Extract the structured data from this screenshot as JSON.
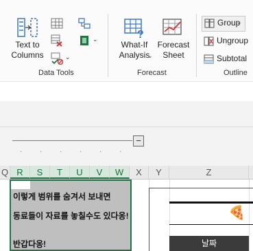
{
  "ribbon": {
    "data_tools": {
      "group_label": "Data Tools",
      "text_to_columns_label": "Text to\nColumns"
    },
    "forecast": {
      "group_label": "Forecast",
      "what_if_label": "What-If\nAnalysis",
      "forecast_sheet_label": "Forecast\nSheet"
    },
    "outline": {
      "group_label": "Outline",
      "group_button_label": "Group",
      "ungroup_button_label": "Ungroup",
      "subtotal_button_label": "Subtotal"
    }
  },
  "outline_bar": {
    "collapse_button_label": "−"
  },
  "columns": [
    "Q",
    "R",
    "S",
    "T",
    "U",
    "V",
    "W",
    "X",
    "Y",
    "Z"
  ],
  "cells": {
    "line1": "이렇게 범위를 숨겨서 보내면",
    "line2": "동료들이 자료를 놓칠수도 있다옹!",
    "line3": "반갑다옹!",
    "date_header": "날짜",
    "pizza": "🍕"
  },
  "colors": {
    "accent": "#217346",
    "selected_header_bg": "#d7e9dc",
    "hidden_fill": "#bfbfbf",
    "dark_header": "#3b3b3b"
  }
}
